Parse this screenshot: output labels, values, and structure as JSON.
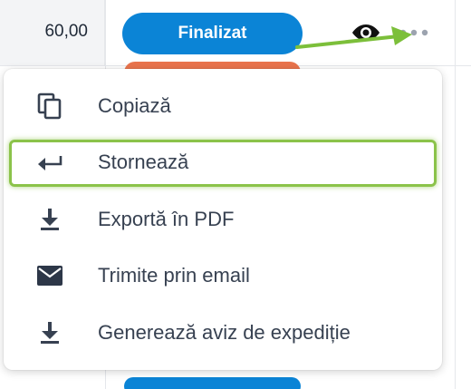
{
  "table": {
    "amount": "60,00",
    "status_label": "Finalizat",
    "status_color": "#0b84d6",
    "row_actions": {
      "view_icon": "eye-icon",
      "more_icon": "more-horizontal-icon"
    }
  },
  "menu": {
    "items": [
      {
        "label": "Copiază",
        "icon": "copy-icon"
      },
      {
        "label": "Stornează",
        "icon": "return-arrow-icon",
        "highlighted": true
      },
      {
        "label": "Exportă în PDF",
        "icon": "download-icon"
      },
      {
        "label": "Trimite prin email",
        "icon": "mail-icon"
      },
      {
        "label": "Generează aviz de expediție",
        "icon": "download-icon"
      }
    ]
  },
  "colors": {
    "accent": "#0b84d6",
    "warning_pill": "#e9744d",
    "highlight": "#8bc34a",
    "text": "#374151"
  }
}
